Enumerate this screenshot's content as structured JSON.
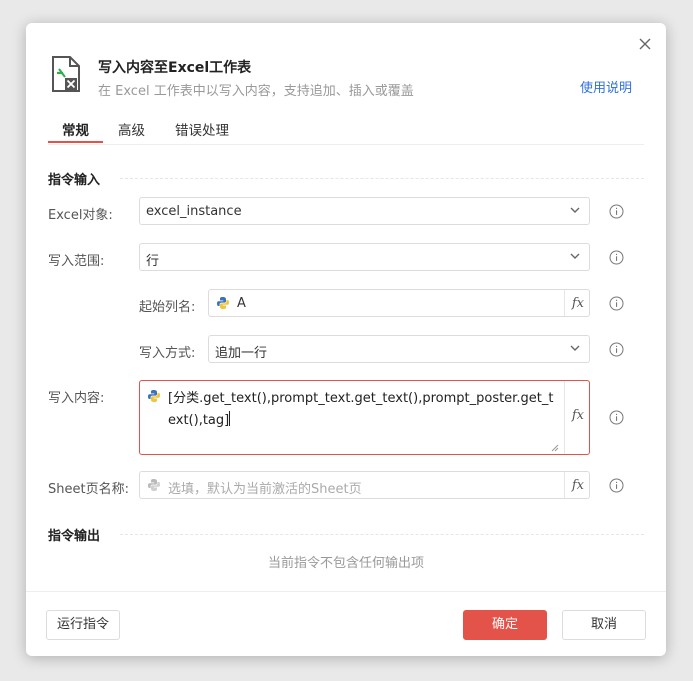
{
  "header": {
    "title": "写入内容至Excel工作表",
    "subtitle": "在 Excel 工作表中以写入内容，支持追加、插入或覆盖",
    "help_label": "使用说明"
  },
  "tabs": [
    {
      "label": "常规",
      "active": true
    },
    {
      "label": "高级",
      "active": false
    },
    {
      "label": "错误处理",
      "active": false
    }
  ],
  "sections": {
    "input_title": "指令输入",
    "output_title": "指令输出"
  },
  "fields": {
    "excel_object": {
      "label": "Excel对象:",
      "value": "excel_instance"
    },
    "write_range": {
      "label": "写入范围:",
      "value": "行"
    },
    "start_column": {
      "label": "起始列名:",
      "value": "A"
    },
    "write_mode": {
      "label": "写入方式:",
      "value": "追加一行"
    },
    "write_content": {
      "label": "写入内容:",
      "value": "[分类.get_text(),prompt_text.get_text(),prompt_poster.get_text(),tag]"
    },
    "sheet_name": {
      "label": "Sheet页名称:",
      "value": "",
      "placeholder": "选填，默认为当前激活的Sheet页"
    }
  },
  "output": {
    "empty_text": "当前指令不包含任何输出项"
  },
  "footer": {
    "run_label": "运行指令",
    "ok_label": "确定",
    "cancel_label": "取消"
  },
  "fx_label": "fx",
  "colors": {
    "accent": "#e4534a",
    "link": "#2f6fe0"
  },
  "icons": [
    "excel-file-icon",
    "close-icon",
    "chevron-down-icon",
    "python-icon",
    "fx-icon",
    "info-icon",
    "resize-handle-icon"
  ]
}
